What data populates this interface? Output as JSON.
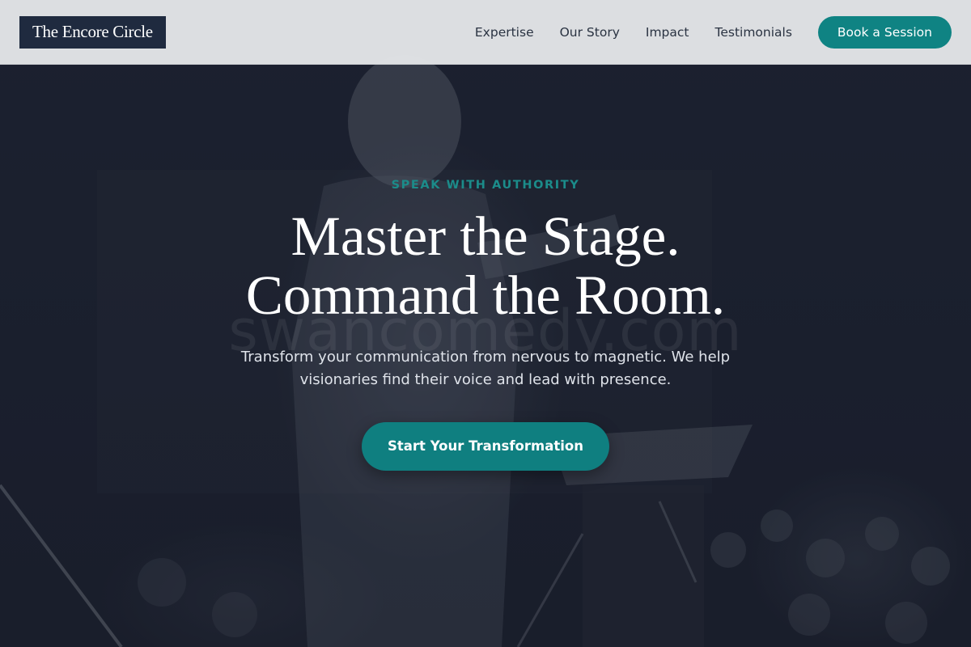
{
  "brand": {
    "name": "The Encore Circle"
  },
  "nav": {
    "links": [
      {
        "label": "Expertise"
      },
      {
        "label": "Our Story"
      },
      {
        "label": "Impact"
      },
      {
        "label": "Testimonials"
      }
    ],
    "cta_label": "Book a Session"
  },
  "hero": {
    "eyebrow": "SPEAK WITH AUTHORITY",
    "headline_line1": "Master the Stage.",
    "headline_line2": "Command the Room.",
    "subtitle": "Transform your communication from nervous to magnetic. We help visionaries find their voice and lead with presence.",
    "cta_label": "Start Your Transformation",
    "watermark": "swancomedy.com"
  },
  "colors": {
    "accent": "#0f8383",
    "header_bg": "#e4e6e8",
    "logo_bg": "#1f2a3f",
    "hero_bg": "#1c2130",
    "eyebrow": "#1b8c8a"
  }
}
